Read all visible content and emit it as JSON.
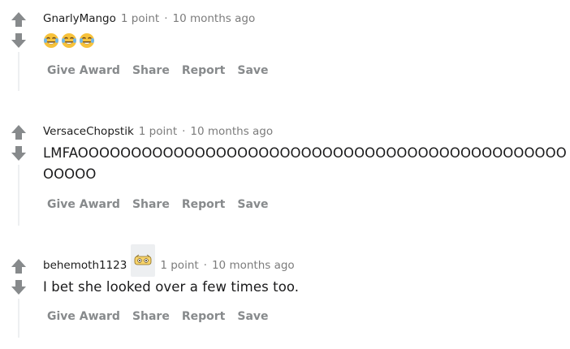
{
  "comments": [
    {
      "author": "GnarlyMango",
      "points": "1 point",
      "separator": "·",
      "time": "10 months ago",
      "body": "",
      "emoji": [
        "tears-of-joy-emoji",
        "tears-of-joy-emoji",
        "tears-of-joy-emoji"
      ],
      "actions": {
        "give_award": "Give Award",
        "share": "Share",
        "report": "Report",
        "save": "Save"
      }
    },
    {
      "author": "VersaceChopstik",
      "points": "1 point",
      "separator": "·",
      "time": "10 months ago",
      "body_line1": "LMFAOOOOOOOOOOOOOOOOOOOOOOOOOOOOOOOOOOOOOOOOOOOOOO",
      "body_line2": "OOOOO",
      "actions": {
        "give_award": "Give Award",
        "share": "Share",
        "report": "Report",
        "save": "Save"
      }
    },
    {
      "author": "behemoth1123",
      "flair_icon": "user-flair-icon",
      "points": "1 point",
      "separator": "·",
      "time": "10 months ago",
      "body": "I bet she looked over a few times too.",
      "actions": {
        "give_award": "Give Award",
        "share": "Share",
        "report": "Report",
        "save": "Save"
      }
    }
  ],
  "colors": {
    "vote_arrow": "#878a8c",
    "meta_gray": "#7c7c7c",
    "thread_line": "#edeff1",
    "emoji_yellow": "#f7c23b"
  }
}
